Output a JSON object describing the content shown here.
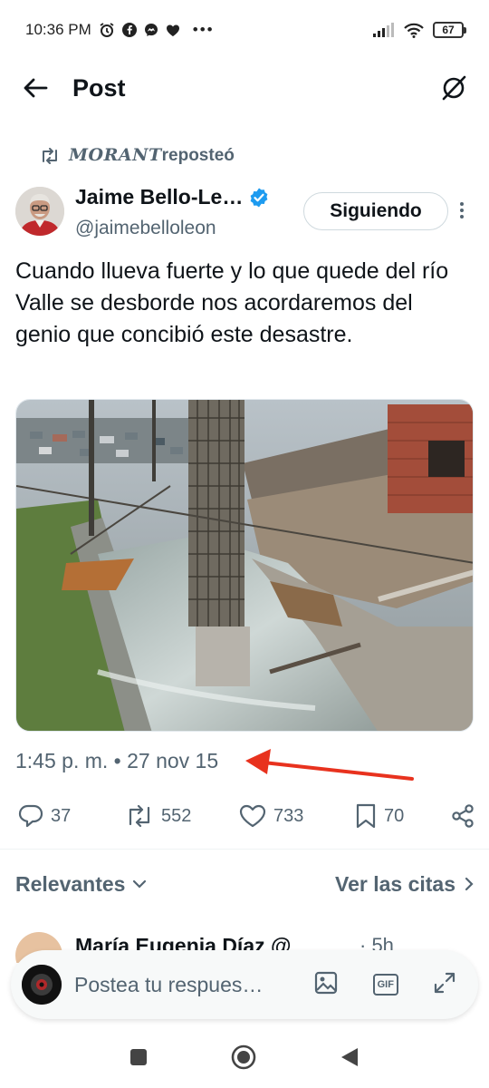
{
  "status_bar": {
    "time": "10:36 PM",
    "dots": "•••",
    "battery": "67"
  },
  "nav": {
    "title": "Post"
  },
  "repost": {
    "user": "MORANT",
    "label": "reposteó"
  },
  "author": {
    "name": "Jaime Bello-Le…",
    "handle": "@jaimebelloleon",
    "follow_label": "Siguiendo"
  },
  "tweet": {
    "text": "Cuando llueva fuerte y lo que quede del río Valle se desborde nos acordaremos del genio que concibió este desastre.",
    "timestamp": "1:45 p. m. • 27 nov 15"
  },
  "actions": {
    "replies": "37",
    "reposts": "552",
    "likes": "733",
    "bookmarks": "70"
  },
  "replies_header": {
    "sort_label": "Relevantes",
    "quotes_label": "Ver las citas"
  },
  "reply_preview": {
    "name": "María Eugenia Díaz @",
    "meta": "· 5h"
  },
  "composer": {
    "placeholder": "Postea tu respues…",
    "gif_label": "GIF"
  },
  "colors": {
    "text": "#0f1419",
    "muted": "#536471",
    "verified": "#1d9bf0",
    "annotation_arrow": "#e8321e"
  }
}
